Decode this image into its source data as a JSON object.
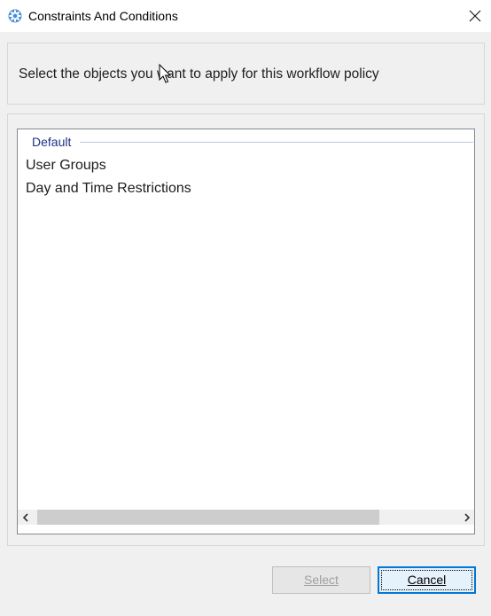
{
  "window": {
    "title": "Constraints And Conditions",
    "icon": "gear-icon",
    "close_icon": "close-icon"
  },
  "header": {
    "instruction": "Select the objects you want to apply for this workflow policy"
  },
  "list": {
    "group_label": "Default",
    "items": [
      {
        "label": "User Groups"
      },
      {
        "label": "Day and Time Restrictions"
      }
    ]
  },
  "buttons": {
    "select_label": "Select",
    "cancel_label": "Cancel"
  },
  "colors": {
    "group_header": "#1e3287",
    "focus_border": "#0078d7",
    "disabled_text": "#a0a0a0"
  }
}
